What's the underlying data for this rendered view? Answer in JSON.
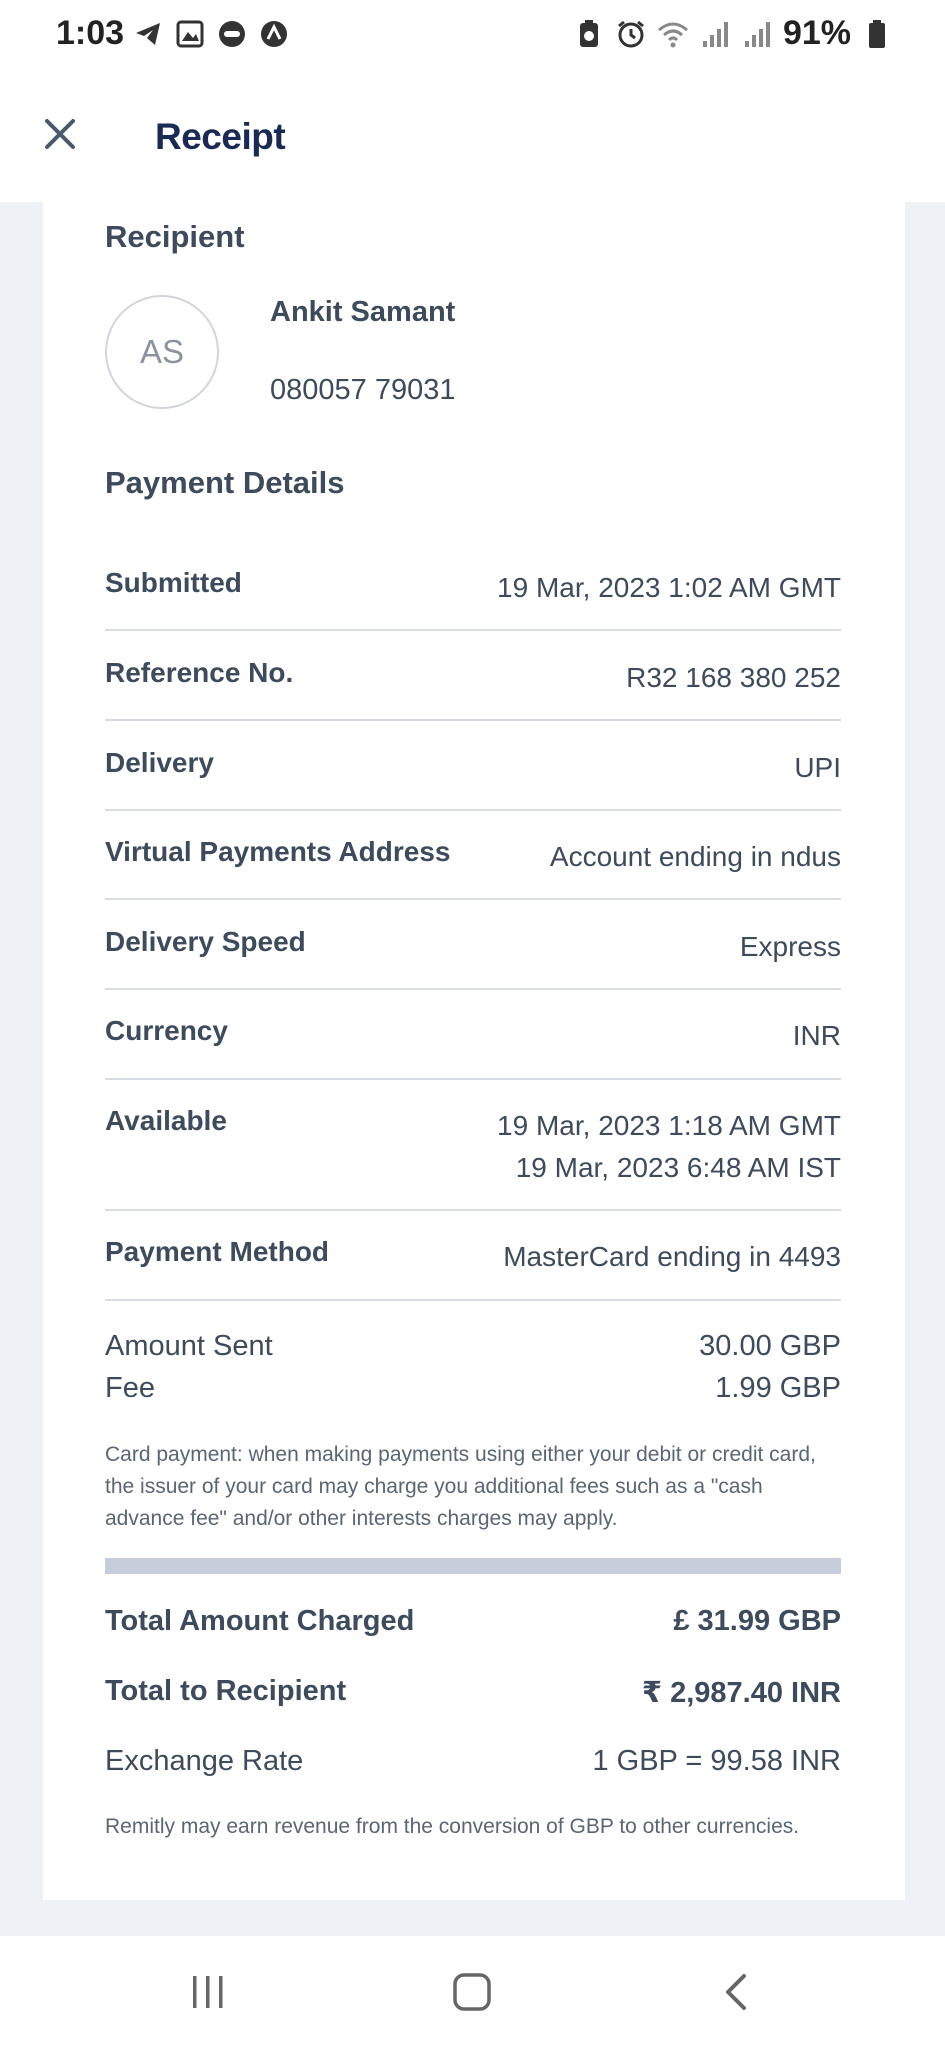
{
  "status_bar": {
    "time": "1:03",
    "battery_percent": "91%",
    "icons_left": [
      "telegram-icon",
      "gallery-icon",
      "chat-icon",
      "vpn-icon"
    ],
    "icons_right": [
      "battery-saver-icon",
      "alarm-icon",
      "wifi-icon",
      "signal-icon",
      "signal-icon",
      "battery-icon"
    ]
  },
  "header": {
    "title": "Receipt",
    "close_icon": "close-icon"
  },
  "recipient": {
    "section_title": "Recipient",
    "initials": "AS",
    "name": "Ankit Samant",
    "phone": "080057 79031"
  },
  "payment_details": {
    "section_title": "Payment Details",
    "rows": [
      {
        "label": "Submitted",
        "value": [
          "19 Mar, 2023 1:02 AM GMT"
        ]
      },
      {
        "label": "Reference No.",
        "value": [
          "R32 168 380 252"
        ]
      },
      {
        "label": "Delivery",
        "value": [
          "UPI"
        ]
      },
      {
        "label": "Virtual Payments Address",
        "value": [
          "Account ending in ndus"
        ]
      },
      {
        "label": "Delivery Speed",
        "value": [
          "Express"
        ]
      },
      {
        "label": "Currency",
        "value": [
          "INR"
        ]
      },
      {
        "label": "Available",
        "value": [
          "19 Mar, 2023 1:18 AM GMT",
          "19 Mar, 2023 6:48 AM IST"
        ]
      },
      {
        "label": "Payment Method",
        "value": [
          "MasterCard ending in 4493"
        ]
      }
    ]
  },
  "amounts": {
    "amount_sent_label": "Amount Sent",
    "amount_sent_value": "30.00 GBP",
    "fee_label": "Fee",
    "fee_value": "1.99 GBP",
    "card_note": "Card payment: when making payments using either your debit or credit card, the issuer of your card may charge you additional fees such as a \"cash advance fee\" and/or other interests charges may apply."
  },
  "totals": {
    "total_charged_label": "Total Amount Charged",
    "total_charged_value": "£ 31.99 GBP",
    "total_recipient_label": "Total to Recipient",
    "total_recipient_value": "₹ 2,987.40 INR",
    "exchange_rate_label": "Exchange Rate",
    "exchange_rate_value": "1 GBP = 99.58 INR",
    "revenue_note": "Remitly may earn revenue from the conversion of GBP to other currencies."
  },
  "nav_bar": {
    "icons": [
      "recent-apps-icon",
      "home-icon",
      "back-icon"
    ]
  }
}
